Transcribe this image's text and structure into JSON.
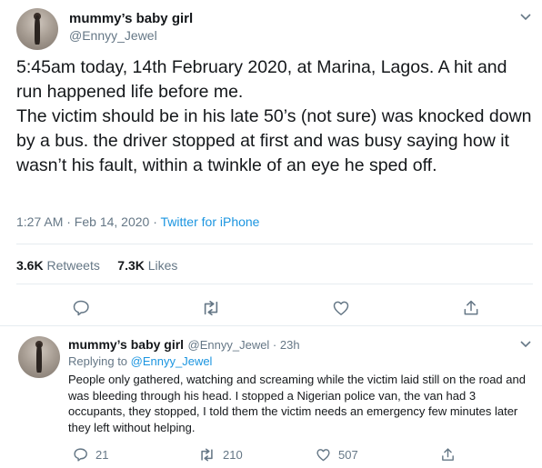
{
  "main_tweet": {
    "display_name": "mummy’s baby girl",
    "handle": "@Ennyy_Jewel",
    "text": "5:45am today, 14th February 2020, at Marina, Lagos. A hit and run happened life before me.\nThe victim should be in his late 50’s (not sure) was knocked down by a bus. the driver stopped at first and was busy saying how it wasn’t his fault, within a twinkle of an eye he sped off.",
    "time": "1:27 AM · Feb 14, 2020",
    "separator": " · ",
    "source": "Twitter for iPhone",
    "retweets_count": "3.6K",
    "retweets_label": "Retweets",
    "likes_count": "7.3K",
    "likes_label": "Likes"
  },
  "reply_tweet": {
    "display_name": "mummy’s baby girl",
    "handle_time": "@Ennyy_Jewel · 23h",
    "replying_prefix": "Replying to ",
    "replying_to": "@Ennyy_Jewel",
    "text": "People only gathered, watching and screaming while the victim laid still on the road and was bleeding through his head. I stopped a Nigerian police van, the van had 3 occupants, they stopped, I told them the victim needs an emergency few minutes later they left without helping.",
    "reply_count": "21",
    "retweet_count": "210",
    "like_count": "507"
  },
  "icons": {
    "chevron": "chevron-down-icon",
    "reply": "reply-icon",
    "retweet": "retweet-icon",
    "like": "heart-icon",
    "share": "share-icon"
  },
  "colors": {
    "accent": "#1b95e0",
    "text": "#14171a",
    "secondary": "#657786",
    "border": "#e6ecf0"
  }
}
